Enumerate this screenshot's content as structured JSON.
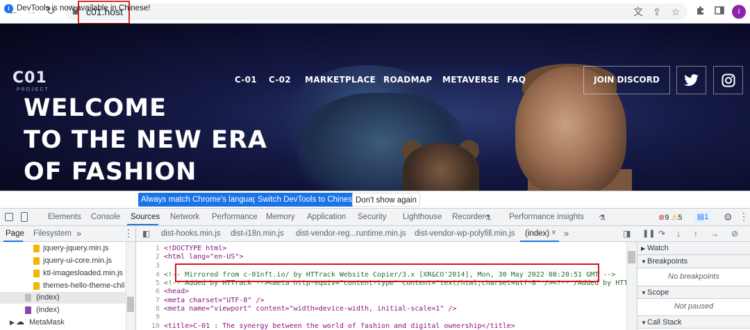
{
  "browser": {
    "url": "c01.host"
  },
  "site": {
    "logo_main": "C01",
    "logo_sub": "PROJECT",
    "menu": [
      "C-01",
      "C-02",
      "MARKETPLACE",
      "ROADMAP",
      "METAVERSE",
      "FAQ"
    ],
    "join_label": "JOIN DISCORD",
    "headline": [
      "WELCOME",
      "TO THE NEW ERA",
      "OF FASHION"
    ]
  },
  "infobar": {
    "text": "DevTools is now available in Chinese!",
    "btn1": "Always match Chrome's language",
    "btn2": "Switch DevTools to Chinese",
    "btn3": "Don't show again"
  },
  "devtools": {
    "tabs": [
      "Elements",
      "Console",
      "Sources",
      "Network",
      "Performance",
      "Memory",
      "Application",
      "Security",
      "Lighthouse",
      "Recorder",
      "Performance insights"
    ],
    "errors": "9",
    "warnings": "5",
    "messages": "1",
    "nav_tabs": [
      "Page",
      "Filesystem"
    ],
    "files": [
      "jquery-jquery.min.js",
      "jquery-ui-core.min.js",
      "ktl-imagesloaded.min.js",
      "themes-hello-theme-chil",
      "(index)",
      "(index)",
      "MetaMask"
    ],
    "file_tabs": [
      "dist-hooks.min.js",
      "dist-i18n.min.js",
      "dist-vendor-reg...runtime.min.js",
      "dist-vendor-wp-polyfill.min.js",
      "(index)"
    ],
    "code_lines": [
      {
        "n": "1",
        "t": "<!DOCTYPE html>"
      },
      {
        "n": "2",
        "t": "<html lang=\"en-US\">"
      },
      {
        "n": "3",
        "t": ""
      },
      {
        "n": "4",
        "t": "<!-- Mirrored from c-01nft.io/ by HTTrack Website Copier/3.x [XR&CO'2014], Mon, 30 May 2022 08:20:51 GMT -->"
      },
      {
        "n": "5",
        "t": "<!-- Added by HTTrack --><meta http-equiv=\"content-type\" content=\"text/html;charset=utf-8\" /><!-- /Added by HTTrack -->"
      },
      {
        "n": "6",
        "t": "<head>"
      },
      {
        "n": "7",
        "t": "<meta charset=\"UTF-8\" />"
      },
      {
        "n": "8",
        "t": "<meta name=\"viewport\" content=\"width=device-width, initial-scale=1\" />"
      },
      {
        "n": "9",
        "t": ""
      },
      {
        "n": "10",
        "t": "<title>C-01 : The synergy between the world of fashion and digital ownership</title>"
      }
    ],
    "sections": [
      "Watch",
      "Breakpoints",
      "Scope",
      "Call Stack"
    ],
    "no_breakpoints": "No breakpoints",
    "not_paused": "Not paused"
  }
}
